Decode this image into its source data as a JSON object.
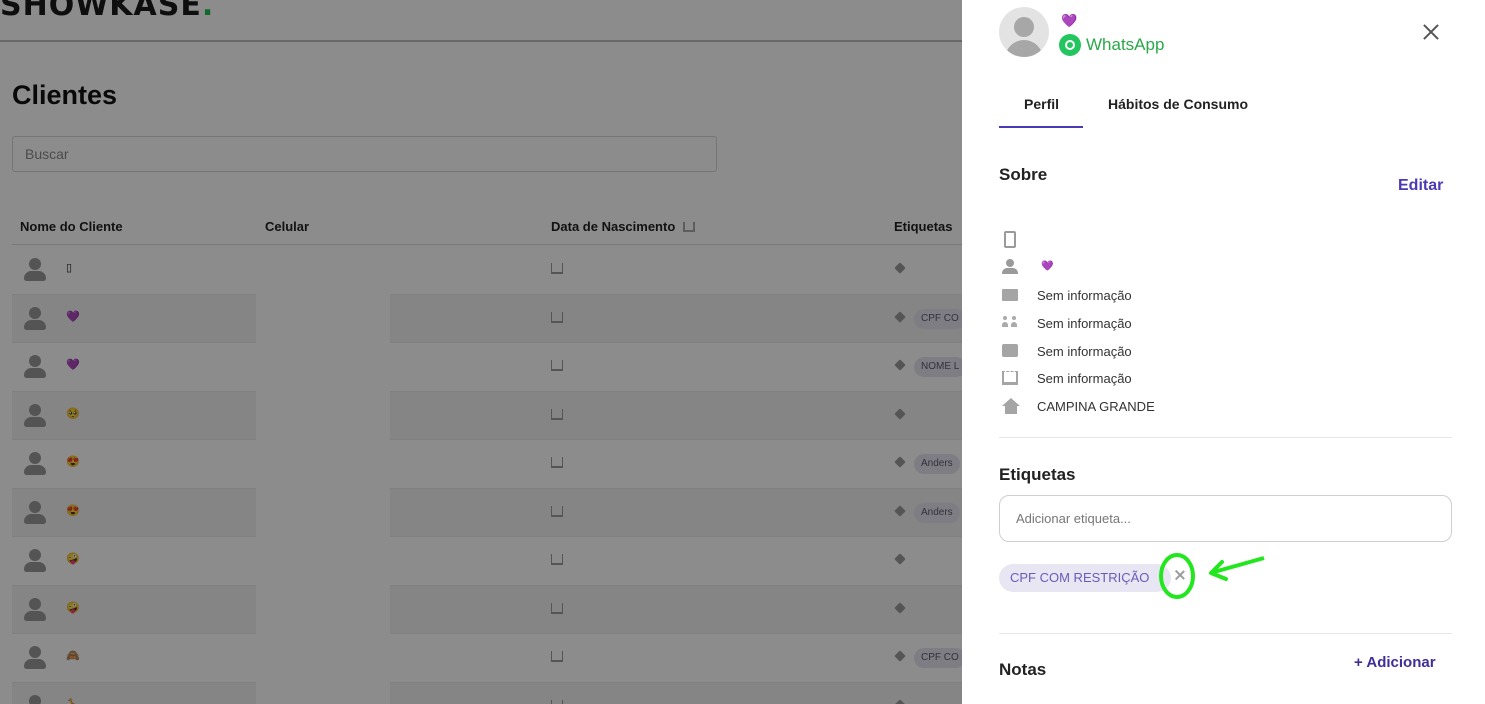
{
  "app": {
    "logo_text": "SHOWKASE",
    "logo_dot": ".",
    "page_title": "Clientes",
    "search": {
      "placeholder": "Buscar"
    },
    "table": {
      "headers": {
        "name": "Nome do Cliente",
        "phone": "Celular",
        "birth": "Data de Nascimento",
        "tags": "Etiquetas"
      },
      "rows": [
        {
          "emoji": "▯",
          "tag": ""
        },
        {
          "emoji": "💜",
          "tag": "CPF CO"
        },
        {
          "emoji": "💜",
          "tag": "NOME L"
        },
        {
          "emoji": "🥺",
          "tag": ""
        },
        {
          "emoji": "😍",
          "tag": "Anders"
        },
        {
          "emoji": "😍",
          "tag": "Anders"
        },
        {
          "emoji": "🤪",
          "tag": ""
        },
        {
          "emoji": "🤪",
          "tag": ""
        },
        {
          "emoji": "🙈",
          "tag": "CPF CO"
        },
        {
          "emoji": "🦒",
          "tag": ""
        }
      ]
    }
  },
  "drawer": {
    "name_emoji": "💜",
    "channel": "WhatsApp",
    "tabs": {
      "profile": "Perfil",
      "habits": "Hábitos de Consumo"
    },
    "about": {
      "title": "Sobre",
      "edit": "Editar",
      "name_emoji": "💜",
      "email": "Sem informação",
      "gender": "Sem informação",
      "document": "Sem informação",
      "birthday": "Sem informação",
      "city": "CAMPINA GRANDE"
    },
    "tags": {
      "title": "Etiquetas",
      "placeholder": "Adicionar etiqueta...",
      "items": [
        "CPF COM RESTRIÇÃO"
      ]
    },
    "notes": {
      "title": "Notas",
      "add": "+ Adicionar"
    }
  },
  "colors": {
    "accent": "#4a3ab4",
    "whatsapp": "#22c55e",
    "annotation": "#22e61e",
    "chip_bg": "#e9e6f3",
    "chip_text": "#6b5bb8"
  }
}
